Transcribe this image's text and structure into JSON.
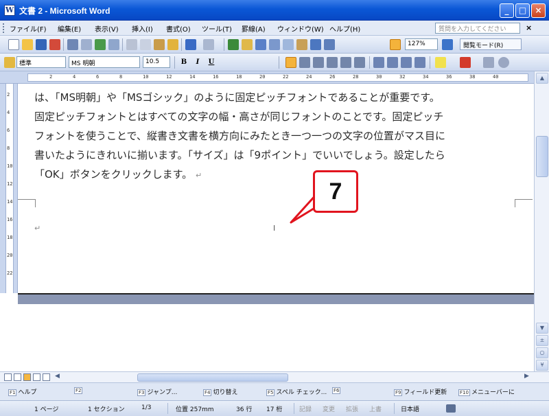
{
  "window": {
    "title": "文書 2 - Microsoft Word",
    "controls": {
      "minimize": "_",
      "maximize": "□",
      "close": "×"
    }
  },
  "menu": {
    "items": [
      "ファイル(F)",
      "編集(E)",
      "表示(V)",
      "挿入(I)",
      "書式(O)",
      "ツール(T)",
      "罫線(A)",
      "ウィンドウ(W)",
      "ヘルプ(H)"
    ],
    "help_search_placeholder": "質問を入力してください",
    "close_glyph": "×"
  },
  "standard_toolbar": {
    "zoom": "127%",
    "reading_mode": "閲覧モード(R)"
  },
  "format_toolbar": {
    "style": "標準",
    "font": "MS 明朝",
    "size": "10.5",
    "bold": "B",
    "italic": "I",
    "underline": "U"
  },
  "ruler": {
    "ticks": [
      "2",
      "4",
      "6",
      "8",
      "10",
      "12",
      "14",
      "16",
      "18",
      "20",
      "22",
      "24",
      "26",
      "28",
      "30",
      "32",
      "34",
      "36",
      "38",
      "40"
    ]
  },
  "vruler": {
    "ticks": [
      "2",
      "4",
      "6",
      "8",
      "10",
      "12",
      "14",
      "16",
      "18",
      "20",
      "22"
    ]
  },
  "document": {
    "lines": [
      "は、「MS明朝」や「MSゴシック」のように固定ピッチフォントであることが重要です。",
      "固定ピッチフォントとはすべての文字の幅・高さが同じフォントのことです。固定ピッチ",
      "フォントを使うことで、縦書き文書を横方向にみたとき一つ一つの文字の位置がマス目に",
      "書いたようにきれいに揃います。「サイズ」は「9ポイント」でいいでしょう。設定したら",
      "「OK」ボタンをクリックします。"
    ],
    "paragraph_mark": "↵",
    "ibeam_cursor": "I"
  },
  "annotation": {
    "step_number": "7",
    "accent_color": "#e1141e"
  },
  "vertical_scrollbar": {
    "up": "▲",
    "down": "▼",
    "prev_page": "±",
    "select_browse": "○",
    "next_page": "¥"
  },
  "horizontal_scrollbar": {
    "left": "◀",
    "right": "▶"
  },
  "function_keys": [
    {
      "key": "F1",
      "label": "ヘルプ"
    },
    {
      "key": "F2",
      "label": ""
    },
    {
      "key": "F3",
      "label": "ジャンプ..."
    },
    {
      "key": "F4",
      "label": "切り替え"
    },
    {
      "key": "F5",
      "label": "スペル チェック..."
    },
    {
      "key": "F6",
      "label": ""
    },
    {
      "key": "F9",
      "label": "フィールド更新"
    },
    {
      "key": "F10",
      "label": "メニューバーに"
    }
  ],
  "status": {
    "page": "1 ページ",
    "section": "1 セクション",
    "page_of": "1/3",
    "position": "位置 257mm",
    "line": "36 行",
    "column": "17 桁",
    "rec": "記録",
    "trk": "変更",
    "ext": "拡張",
    "ovr": "上書",
    "language": "日本語"
  }
}
